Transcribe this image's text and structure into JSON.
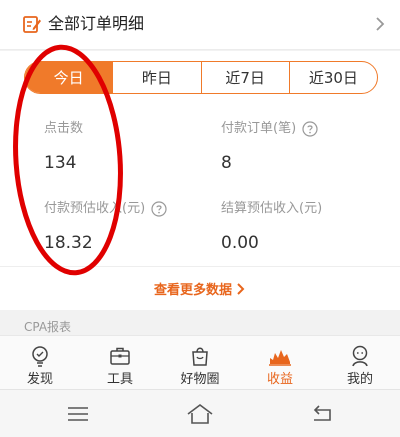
{
  "header": {
    "title": "全部订单明细"
  },
  "tabs": [
    {
      "label": "今日",
      "active": true
    },
    {
      "label": "昨日",
      "active": false
    },
    {
      "label": "近7日",
      "active": false
    },
    {
      "label": "近30日",
      "active": false
    }
  ],
  "stats": [
    {
      "label": "点击数",
      "value": "134",
      "has_help": false
    },
    {
      "label": "付款订单(笔)",
      "value": "8",
      "has_help": true
    },
    {
      "label": "付款预估收入(元)",
      "value": "18.32",
      "has_help": true
    },
    {
      "label": "结算预估收入(元)",
      "value": "0.00",
      "has_help": false
    }
  ],
  "more_link": "查看更多数据",
  "section_title": "CPA报表",
  "tabbar": [
    {
      "label": "发现",
      "icon": "bulb-icon"
    },
    {
      "label": "工具",
      "icon": "toolbox-icon"
    },
    {
      "label": "好物圈",
      "icon": "bag-icon"
    },
    {
      "label": "收益",
      "icon": "chart-icon"
    },
    {
      "label": "我的",
      "icon": "person-icon"
    }
  ],
  "colors": {
    "accent": "#f07a2a",
    "annotation": "#e00000"
  }
}
